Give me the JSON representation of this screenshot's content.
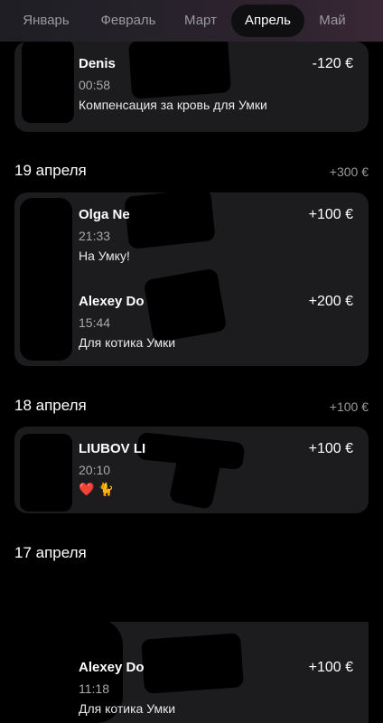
{
  "months": [
    {
      "label": "Январь"
    },
    {
      "label": "Февраль"
    },
    {
      "label": "Март"
    },
    {
      "label": "Апрель",
      "active": true
    },
    {
      "label": "Май"
    }
  ],
  "top_card": {
    "name": "Denis",
    "time": "00:58",
    "description": "Компенсация за кровь для Умки",
    "amount": "-120 €"
  },
  "groups": [
    {
      "date": "19 апреля",
      "total": "+300 €",
      "transactions": [
        {
          "name": "Olga Ne",
          "time": "21:33",
          "description": "На Умку!",
          "amount": "+100 €"
        },
        {
          "name": "Alexey Do",
          "time": "15:44",
          "description": "Для котика Умки",
          "amount": "+200 €"
        }
      ]
    },
    {
      "date": "18 апреля",
      "total": "+100 €",
      "transactions": [
        {
          "name": "LIUBOV LI",
          "time": "20:10",
          "description": "❤️ 🐈",
          "amount": "+100 €"
        }
      ]
    },
    {
      "date": "17 апреля",
      "total": "",
      "transactions": [
        {
          "name": "Alexey Do",
          "time": "11:18",
          "description": "Для котика Умки",
          "amount": "+100 €"
        }
      ]
    }
  ],
  "colors": {
    "background": "#000000",
    "card": "#1c1c1e",
    "secondary_text": "#9a9aa0",
    "active_tab": "#0f0f12"
  }
}
